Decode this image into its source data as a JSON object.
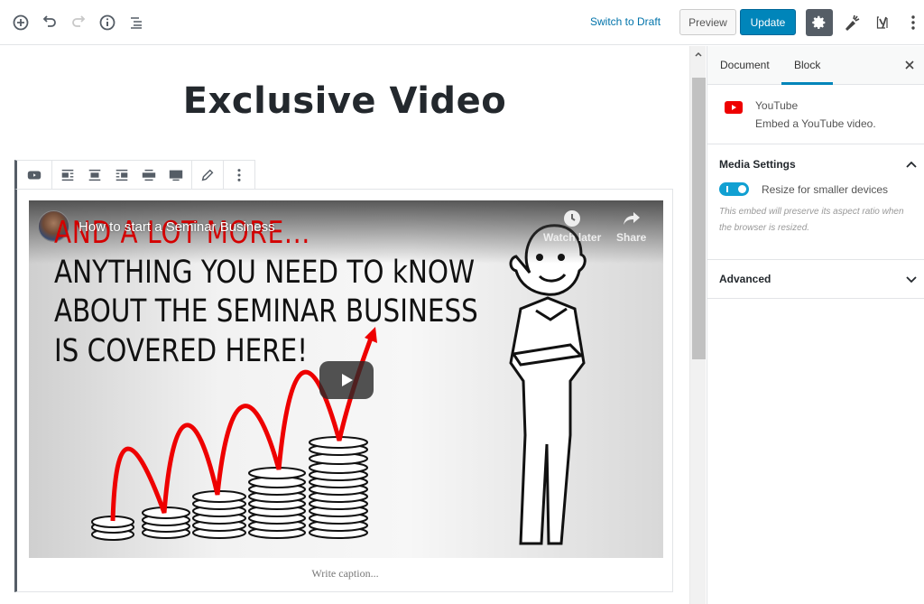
{
  "topbar": {
    "left_icons": [
      {
        "name": "add-block-icon"
      },
      {
        "name": "undo-icon"
      },
      {
        "name": "redo-icon"
      },
      {
        "name": "info-icon"
      },
      {
        "name": "outline-icon"
      }
    ],
    "switch_to_draft": "Switch to Draft",
    "preview_label": "Preview",
    "update_label": "Update",
    "right_icons": [
      "gear-icon",
      "carrot-icon",
      "yoast-icon",
      "more-vertical-icon"
    ],
    "colors": {
      "primary": "#0085ba",
      "link": "#0073aa",
      "settings_bg": "#555d66"
    }
  },
  "editor": {
    "post_title": "Exclusive Video",
    "block_toolbar": {
      "block_type_icon": "youtube-block-icon",
      "alignment_icons": [
        "align-left-icon",
        "align-center-icon",
        "align-right-icon",
        "align-wide-icon",
        "align-full-icon"
      ],
      "edit_icon": "pencil-icon",
      "more_icon": "more-vertical-icon"
    },
    "embed": {
      "video_title": "How to start a Seminar Business",
      "watch_later": "Watch later",
      "share": "Share",
      "thumbnail_text": {
        "red_heading": "AND A LOT MORE...",
        "lines": [
          "ANYTHING YOU NEED TO kNOW",
          "ABOUT THE SEMINAR BUSINESS",
          "IS COVERED HERE!"
        ]
      }
    },
    "caption_placeholder": "Write caption..."
  },
  "sidebar": {
    "tabs": [
      {
        "label": "Document",
        "active": false
      },
      {
        "label": "Block",
        "active": true
      }
    ],
    "block_card": {
      "title": "YouTube",
      "description": "Embed a YouTube video."
    },
    "media_settings": {
      "title": "Media Settings",
      "expanded": true,
      "toggle_label": "Resize for smaller devices",
      "toggle_on": true,
      "help": "This embed will preserve its aspect ratio when the browser is resized."
    },
    "advanced": {
      "title": "Advanced",
      "expanded": false
    }
  }
}
